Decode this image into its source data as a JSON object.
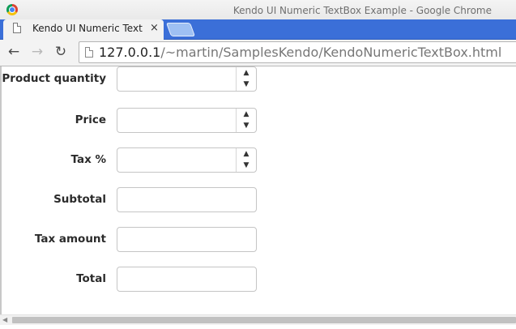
{
  "window": {
    "title": "Kendo UI Numeric TextBox Example - Google Chrome"
  },
  "tab": {
    "title": "Kendo UI Numeric Text",
    "close_glyph": "×"
  },
  "nav": {
    "back_glyph": "←",
    "forward_glyph": "→",
    "reload_glyph": "↻"
  },
  "address": {
    "host": "127.0.0.1",
    "path": "/~martin/SamplesKendo/KendoNumericTextBox.html"
  },
  "form": {
    "fields": [
      {
        "label": "Product quantity",
        "value": "",
        "spinner": true
      },
      {
        "label": "Price",
        "value": "",
        "spinner": true
      },
      {
        "label": "Tax %",
        "value": "",
        "spinner": true
      },
      {
        "label": "Subtotal",
        "value": "",
        "spinner": false
      },
      {
        "label": "Tax amount",
        "value": "",
        "spinner": false
      },
      {
        "label": "Total",
        "value": "",
        "spinner": false
      }
    ],
    "spin_up_glyph": "▲",
    "spin_down_glyph": "▼"
  },
  "scrollbar": {
    "left_arrow_glyph": "◀"
  },
  "colors": {
    "tabstrip": "#3b6fd8",
    "label_text": "#2b2b2b",
    "field_border": "#c5c5c5"
  }
}
